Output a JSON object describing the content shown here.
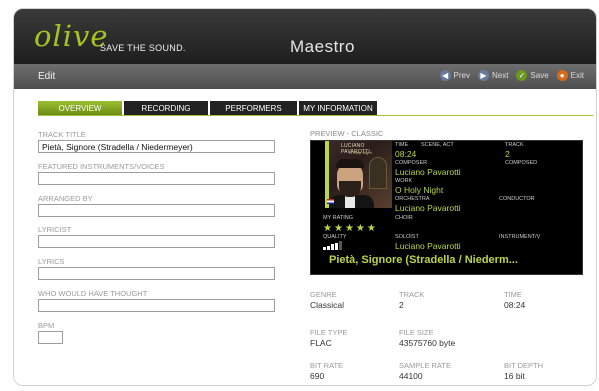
{
  "brand": {
    "logo_text": "olive",
    "tagline": "SAVE THE SOUND.",
    "app_title": "Maestro",
    "accent": "#a6c41f"
  },
  "editbar": {
    "title": "Edit",
    "actions": [
      {
        "label": "Prev",
        "icon": "arrow-left-icon",
        "color": "#6b7a9a"
      },
      {
        "label": "Next",
        "icon": "arrow-right-icon",
        "color": "#6b7a9a"
      },
      {
        "label": "Save",
        "icon": "checkmark-icon",
        "color": "#6a9a1f"
      },
      {
        "label": "Exit",
        "icon": "power-icon",
        "color": "#d66a16"
      }
    ]
  },
  "tabs": [
    {
      "label": "OVERVIEW",
      "active": true
    },
    {
      "label": "RECORDING",
      "active": false
    },
    {
      "label": "PERFORMERS",
      "active": false
    },
    {
      "label": "MY INFORMATION",
      "active": false
    }
  ],
  "form": {
    "track_title_label": "TRACK TITLE",
    "track_title_value": "Pietà, Signore (Stradella / Niedermeyer)",
    "featured_label": "FEATURED INSTRUMENTS/VOICES",
    "featured_value": "",
    "arranged_label": "ARRANGED BY",
    "arranged_value": "",
    "lyricist_label": "LYRICIST",
    "lyricist_value": "",
    "lyrics_label": "LYRICS",
    "lyrics_value": "",
    "who_label": "WHO WOULD HAVE THOUGHT",
    "who_value": "",
    "bpm_label": "BPM",
    "bpm_value": ""
  },
  "preview": {
    "label": "PREVIEW - CLASSIC",
    "cover_title": "LUCIANO PAVAROTTI",
    "cover_subtitle": "O Holy Night",
    "time_label": "TIME",
    "scene_label": "SCENE, ACT",
    "time_value": "08:24",
    "track_label": "TRACK",
    "track_value": "2",
    "composer_label": "COMPOSER",
    "composer_value": "Luciano Pavarotti",
    "composed_label": "COMPOSED",
    "work_label": "WORK",
    "work_value": "O Holy Night",
    "orchestra_label": "ORCHESTRA",
    "orchestra_value": "Luciano Pavarotti",
    "conductor_label": "CONDUCTOR",
    "rating_label": "MY RATING",
    "rating": 5,
    "choir_label": "CHOIR",
    "quality_label": "QUALITY",
    "quality_level": 4,
    "soloist_label": "SOLOIST",
    "soloist_value": "Luciano Pavarotti",
    "instrument_label": "INSTRUMENT/V",
    "track_title_display": "Pietà, Signore (Stradella / Niederm..."
  },
  "meta": {
    "genre_label": "GENRE",
    "genre_value": "Classical",
    "track_label": "TRACK",
    "track_value": "2",
    "time_label": "TIME",
    "time_value": "08:24",
    "filetype_label": "FILE TYPE",
    "filetype_value": "FLAC",
    "filesize_label": "FILE SIZE",
    "filesize_value": "43575760 byte",
    "bitrate_label": "BIT RATE",
    "bitrate_value": "690",
    "samplerate_label": "SAMPLE RATE",
    "samplerate_value": "44100",
    "bitdepth_label": "BIT DEPTH",
    "bitdepth_value": "16 bit"
  }
}
